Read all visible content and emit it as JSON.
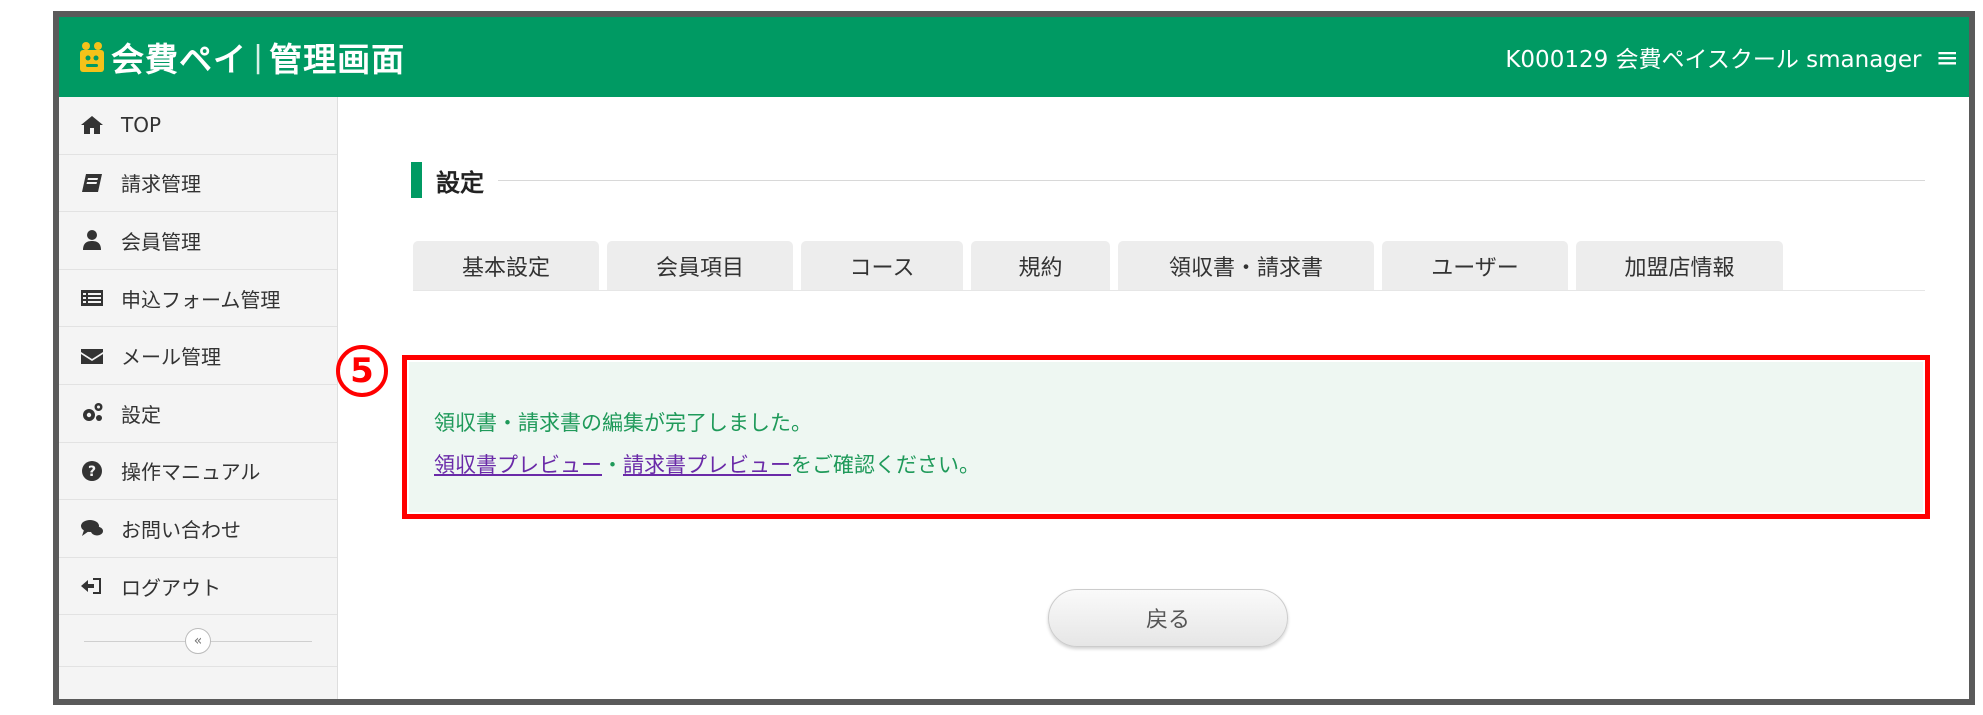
{
  "header": {
    "brand_name": "会費ペイ",
    "brand_separator": "|",
    "brand_sub": "管理画面",
    "account_text": "K000129 会費ペイスクール smanager",
    "menu_icon_glyph": "≡",
    "color": "#009a63"
  },
  "sidebar": {
    "items": [
      {
        "label": "TOP",
        "icon": "home-icon"
      },
      {
        "label": "請求管理",
        "icon": "book-icon"
      },
      {
        "label": "会員管理",
        "icon": "user-icon"
      },
      {
        "label": "申込フォーム管理",
        "icon": "list-icon"
      },
      {
        "label": "メール管理",
        "icon": "envelope-icon"
      },
      {
        "label": "設定",
        "icon": "gears-icon"
      },
      {
        "label": "操作マニュアル",
        "icon": "question-icon"
      },
      {
        "label": "お問い合わせ",
        "icon": "comments-icon"
      },
      {
        "label": "ログアウト",
        "icon": "sign-out-icon"
      }
    ],
    "collapse_glyph": "«"
  },
  "main": {
    "title": "設定",
    "tabs": [
      {
        "label": "基本設定"
      },
      {
        "label": "会員項目"
      },
      {
        "label": "コース"
      },
      {
        "label": "規約"
      },
      {
        "label": "領収書・請求書"
      },
      {
        "label": "ユーザー"
      },
      {
        "label": "加盟店情報"
      }
    ],
    "alert": {
      "message": "領収書・請求書の編集が完了しました。",
      "link1": "領収書プレビュー",
      "separator": "・",
      "link2": "請求書プレビュー",
      "suffix": "をご確認ください。"
    },
    "step_badge": "5",
    "back_button": "戻る"
  }
}
